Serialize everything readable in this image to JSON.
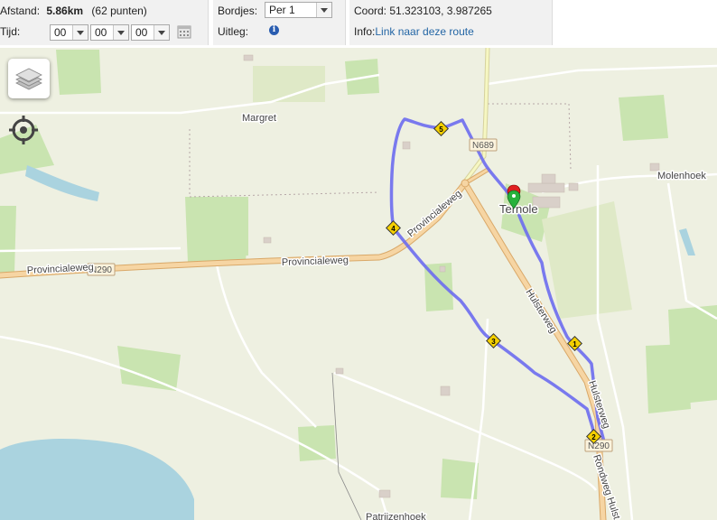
{
  "toolbar": {
    "distance_label": "Afstand:",
    "distance_value": "5.86km",
    "points": "(62 punten)",
    "time_label": "Tijd:",
    "time": {
      "hours": "00",
      "minutes": "00",
      "seconds": "00"
    },
    "signs_label": "Bordjes:",
    "signs_value": "Per 1",
    "explain_label": "Uitleg:",
    "coord_label": "Coord:",
    "coord_value": "51.323103, 3.987265",
    "info_label": "Info:",
    "info_link": "Link naar deze route"
  },
  "map": {
    "labels": {
      "margret": "Margret",
      "molenhoek": "Molenhoek",
      "ternole": "Ternole",
      "provincialeweg_w": "Provincialeweg",
      "provincialeweg_e": "Provincialeweg",
      "provincialeweg_diag": "Provincialeweg",
      "hulsterweg_n": "Hulsterweg",
      "hulsterweg_s": "Hulsterweg",
      "rondweg": "Rondweg Hulst",
      "patrijzenhoek": "Patrijzenhoek"
    },
    "road_shields": {
      "n290_w": "N290",
      "n689": "N689",
      "n290_s": "N290"
    },
    "route_markers": [
      "1",
      "2",
      "3",
      "4",
      "5"
    ],
    "icons": [
      "layers-icon",
      "locate-icon",
      "map-pin-icon",
      "info-icon",
      "calendar-icon"
    ],
    "colors": {
      "route": "#6c6cf0",
      "main_road": "#f3c98c",
      "secondary_road": "#eef0a8",
      "land": "#eef0e1",
      "field": "#c9e4b0",
      "water": "#aad3df",
      "marker": "#f5d000"
    }
  }
}
